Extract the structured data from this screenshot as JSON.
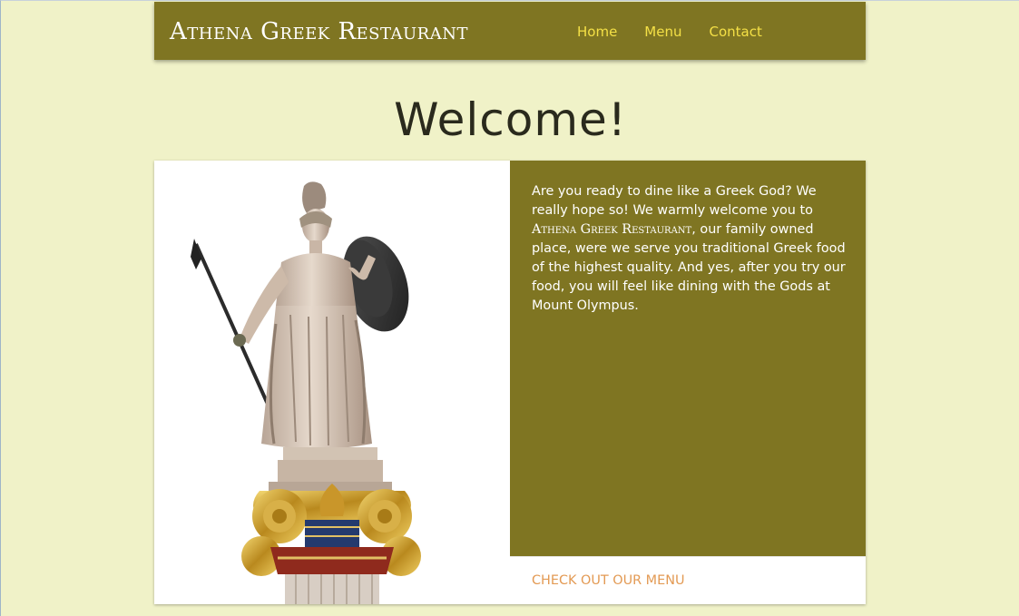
{
  "navbar": {
    "brand": "Athena Greek Restaurant",
    "links": [
      {
        "label": "Home"
      },
      {
        "label": "Menu"
      },
      {
        "label": "Contact"
      }
    ]
  },
  "main": {
    "heading": "Welcome!",
    "card": {
      "image_icon": "athena-statue-icon",
      "text_before": "Are you ready to dine like a Greek God? We really hope so! We warmly welcome you to ",
      "text_brand": "Athena Greek Restaurant",
      "text_after": ", our family owned place, were we serve you traditional Greek food of the highest quality. And yes, after you try our food, you will feel like dining with the Gods at Mount Olympus.",
      "action_label": "Check out our menu"
    }
  },
  "colors": {
    "page_background": "#f0f2c8",
    "primary": "#7f7522",
    "nav_link": "#f4e046",
    "accent_link": "#e39a54",
    "heading": "#2a2a1d"
  }
}
